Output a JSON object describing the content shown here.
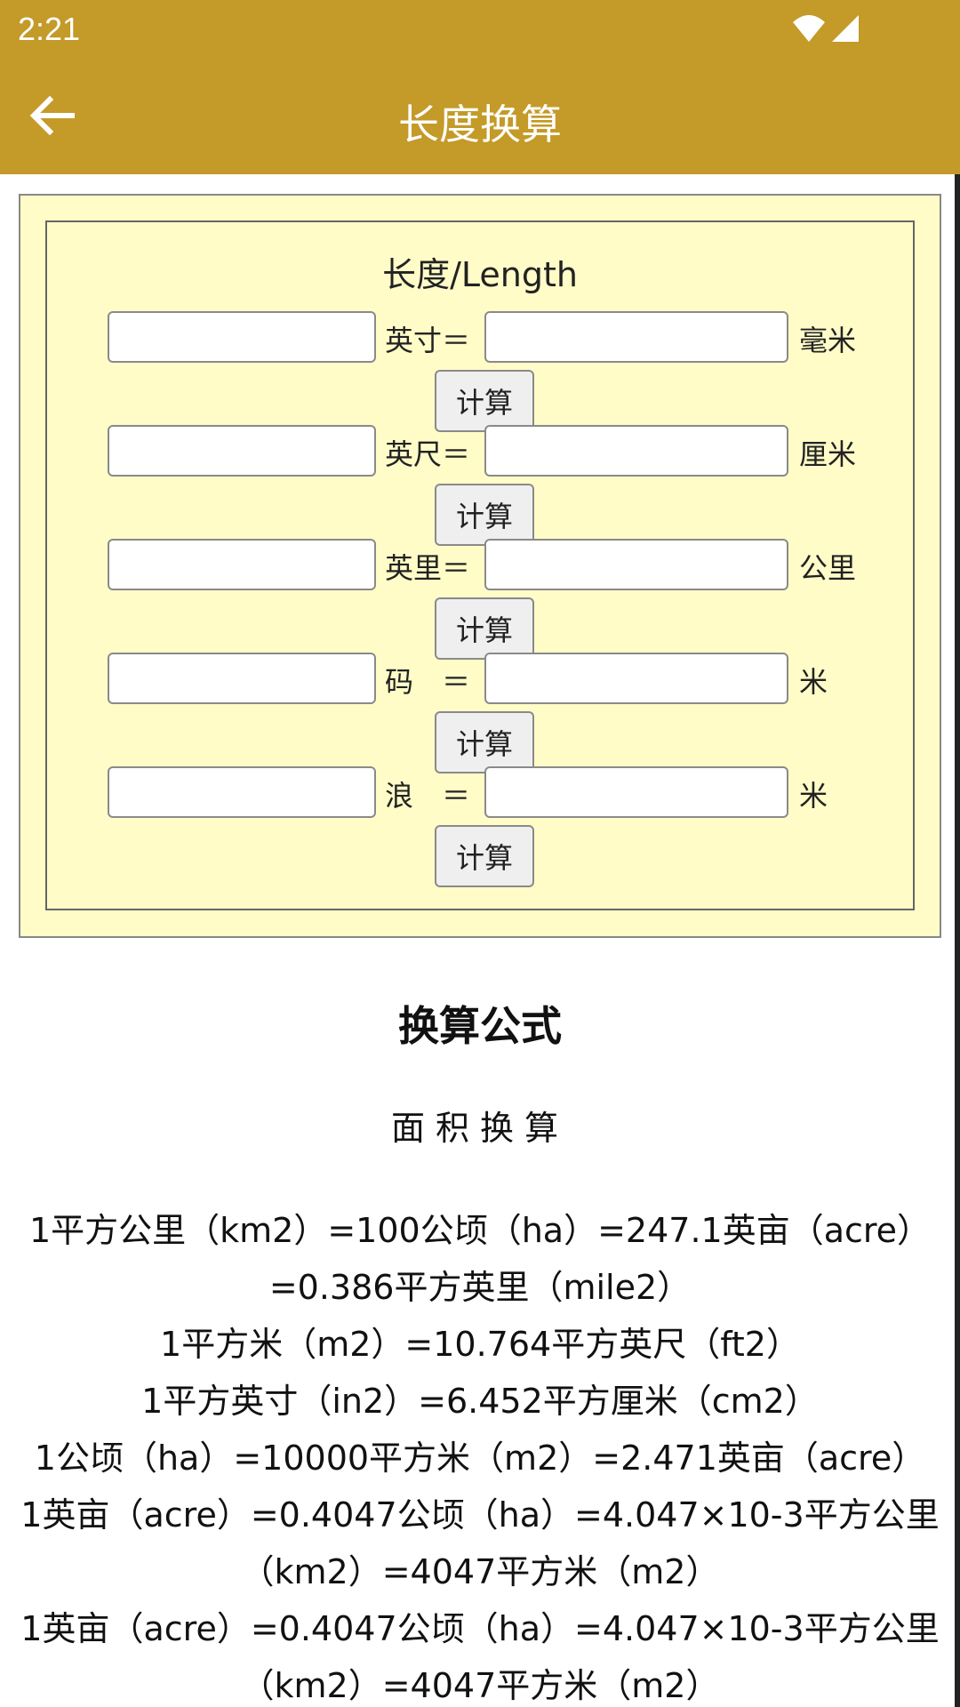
{
  "status_bar": {
    "time": "2:21"
  },
  "app_bar": {
    "title": "长度换算"
  },
  "converter": {
    "section_title": "长度/Length",
    "calc_label": "计算",
    "rows": [
      {
        "left_unit": "英寸＝",
        "right_unit": "毫米"
      },
      {
        "left_unit": "英尺＝",
        "right_unit": "厘米"
      },
      {
        "left_unit": "英里＝",
        "right_unit": "公里"
      },
      {
        "left_unit": "码　＝",
        "right_unit": "米"
      },
      {
        "left_unit": "浪　＝",
        "right_unit": "米"
      }
    ]
  },
  "formulas": {
    "title": "换算公式",
    "subtitle": "面积换算",
    "lines": [
      "1平方公里（km2）=100公顷（ha）=247.1英亩（acre）=0.386平方英里（mile2）",
      "1平方米（m2）=10.764平方英尺（ft2）",
      "1平方英寸（in2）=6.452平方厘米（cm2）",
      "1公顷（ha）=10000平方米（m2）=2.471英亩（acre）",
      "1英亩（acre）=0.4047公顷（ha）=4.047×10-3平方公里（km2）=4047平方米（m2）",
      "1英亩（acre）=0.4047公顷（ha）=4.047×10-3平方公里（km2）=4047平方米（m2）"
    ]
  }
}
